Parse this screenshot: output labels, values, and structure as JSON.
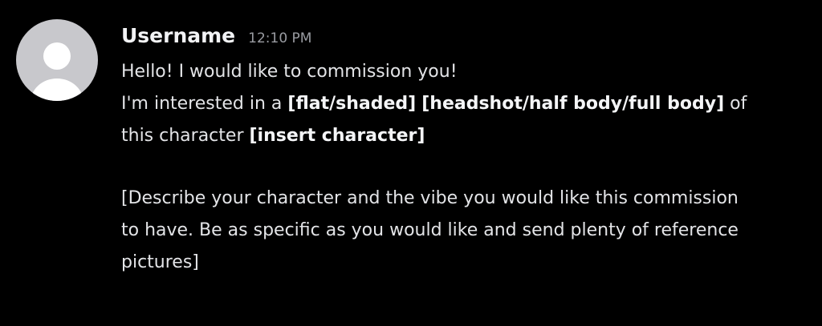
{
  "message": {
    "username": "Username",
    "timestamp": "12:10 PM",
    "line1": "Hello! I would like to commission you!",
    "line2_prefix": "I'm interested in a ",
    "line2_bold1": "[flat/shaded]",
    "line2_space": " ",
    "line2_bold2": "[headshot/half body/full body]",
    "line2_suffix": " of",
    "line3_prefix": "this character ",
    "line3_bold": "[insert character]",
    "line4": "[Describe your character and the vibe you would like this commission",
    "line5": "to have. Be as specific as you would like and send plenty of reference",
    "line6": "pictures]"
  },
  "colors": {
    "background": "#000000",
    "avatar": "#c8c8cc",
    "avatar_figure": "#ffffff",
    "username": "#f2f3f5",
    "timestamp": "#9a9ca2",
    "body_text": "#e3e4e7"
  },
  "icons": {
    "avatar": "default-user-icon"
  }
}
